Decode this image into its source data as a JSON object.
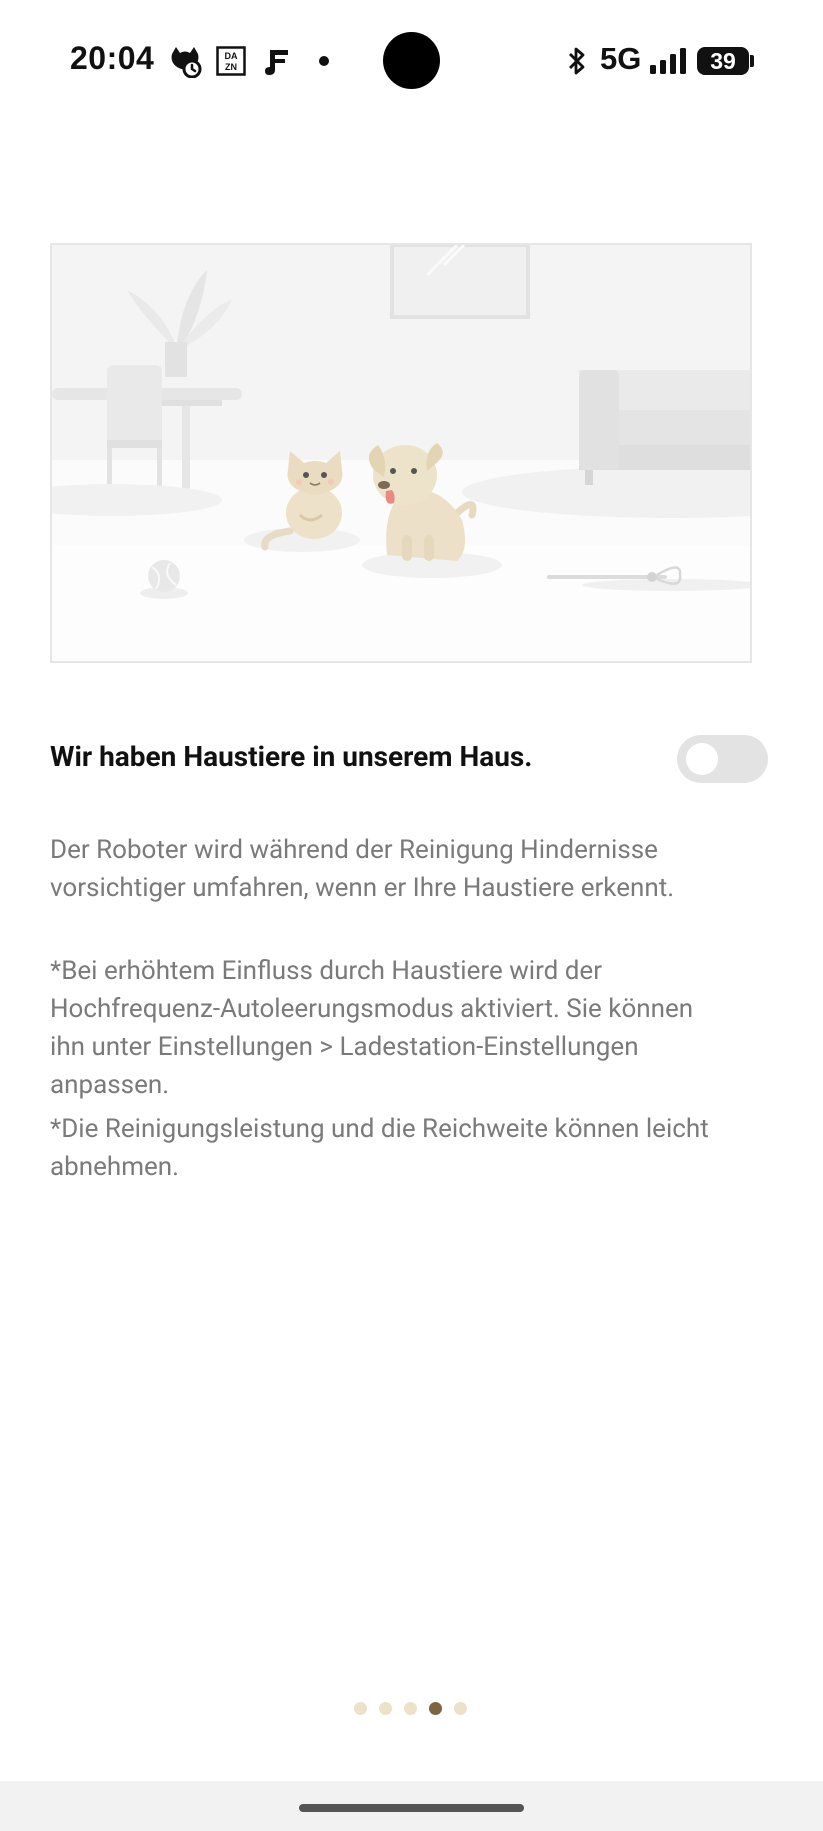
{
  "status_bar": {
    "time": "20:04",
    "network": "5G",
    "battery_level": "39",
    "icons": [
      "cat-alarm-icon",
      "dazn-icon",
      "music-icon",
      "notification-dot-icon",
      "bluetooth-icon",
      "signal-icon",
      "battery-icon"
    ],
    "dazn_label": "DA ZN"
  },
  "illustration": {
    "subject": "pets-in-living-room"
  },
  "setting": {
    "title": "Wir haben Haustiere in unserem Haus.",
    "toggle_on": false
  },
  "description": {
    "main_line1": "Der Roboter wird während der Reinigung Hindernisse",
    "main_line2": "vorsichtiger umfahren, wenn er Ihre Haustiere erkennt.",
    "note1_line1": "*Bei erhöhtem Einfluss durch Haustiere wird der",
    "note1_line2": "Hochfrequenz-Autoleerungsmodus aktiviert. Sie können",
    "note1_line3": "ihn unter Einstellungen > Ladestation-Einstellungen",
    "note1_line4": "anpassen.",
    "note2_line1": "*Die Reinigungsleistung und die Reichweite können leicht",
    "note2_line2": "abnehmen."
  },
  "pager": {
    "total": 5,
    "active_index": 3
  },
  "colors": {
    "accent_dot_active": "#7d6542",
    "dot_inactive": "#ece1c9",
    "toggle_off": "#e3e3e3",
    "text_secondary": "#7a7a7a"
  }
}
